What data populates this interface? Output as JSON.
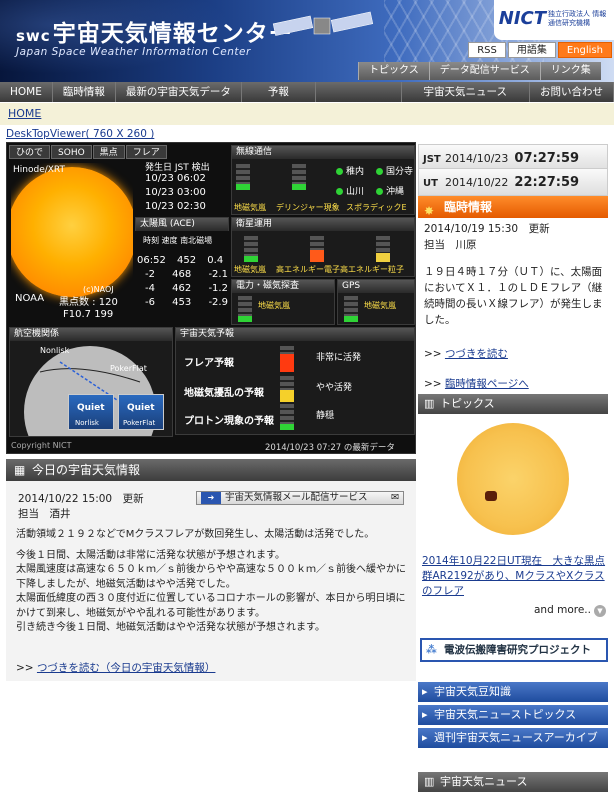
{
  "header": {
    "title_prefix": "swc",
    "title": "宇宙天気情報センター",
    "subtitle": "Japan Space Weather Information Center",
    "org": "NICT",
    "org_sub": "独立行政法人 情報通信研究機構",
    "links": [
      "RSS",
      "用語集",
      "English"
    ],
    "subnav": [
      "トピックス",
      "データ配信サービス",
      "リンク集"
    ]
  },
  "nav": {
    "left": [
      "HOME",
      "臨時情報",
      "最新の宇宙天気データ",
      "予報"
    ],
    "right": [
      "宇宙天気ニュース",
      "お問い合わせ"
    ]
  },
  "breadcrumb": "HOME",
  "viewer_link": "DeskTopViewer( 760 X 260 )",
  "viewer": {
    "tabs": [
      "ひので",
      "SOHO",
      "黒点",
      "フレア"
    ],
    "sun_label": "Hinode/XRT",
    "sun_credit": "(c)NAOJ",
    "noaa_label": "NOAA",
    "sunspot_label": "黒点数 : 120",
    "f107": "F10.7 199",
    "flare_hdr": "発生日 JST 検出",
    "flares": [
      "10/23 06:02",
      "10/23 03:00",
      "10/23 02:30"
    ],
    "wind_hdr": "太陽風 (ACE)",
    "wind_cols": "時刻 速度 南北磁場",
    "wind_rows": [
      [
        "06:52",
        "452",
        "0.4"
      ],
      [
        "-2",
        "468",
        "-2.1"
      ],
      [
        "-4",
        "462",
        "-1.2"
      ],
      [
        "-6",
        "453",
        "-2.9"
      ]
    ],
    "radio_hdr": "無線通信",
    "radio_sites": [
      "稚内",
      "国分寺",
      "山川",
      "沖縄"
    ],
    "radio_labels": [
      "地磁気嵐",
      "デリンジャー現象",
      "スポラディックE"
    ],
    "sat_hdr": "衛星運用",
    "sat_labels": [
      "地磁気嵐",
      "高エネルギー電子",
      "高エネルギー粒子"
    ],
    "power_hdr": "電力・磁気探査",
    "power_label": "地磁気嵐",
    "gps_hdr": "GPS",
    "gps_label": "地磁気嵐",
    "aviation_hdr": "航空機関係",
    "aviation_labels": [
      "Nonlisk",
      "PokerFlat",
      "Quiet",
      "Quiet",
      "Norlisk",
      "PokerFlat"
    ],
    "forecast_hdr": "宇宙天気予報",
    "forecast": [
      {
        "label": "フレア予報",
        "value": "非常に活発"
      },
      {
        "label": "地磁気擾乱の予報",
        "value": "やや活発"
      },
      {
        "label": "プロトン現象の予報",
        "value": "静穏"
      }
    ],
    "copyright": "Copyright NICT",
    "timestamp": "2014/10/23 07:27 の最新データ"
  },
  "clock": {
    "jst_label": "JST",
    "jst": "2014/10/23",
    "jst_time": "07:27:59",
    "ut_label": "UT",
    "ut": "2014/10/22",
    "ut_time": "22:27:59"
  },
  "rinji": {
    "title": "臨時情報",
    "date": "2014/10/19 15:30　更新",
    "author": "担当　川原",
    "body": "１９日４時１７分（ＵＴ）に、太陽面においてＸ１．１のＬＤＥフレア（継続時間の長いＸ線フレア）が発生しました。",
    "more": "つづきを読む",
    "page": "臨時情報ページへ"
  },
  "topics": {
    "title": "トピックス",
    "headline": "2014年10月22日UT現在　大きな黒点群AR2192があり、MクラスやXクラスのフレア",
    "more": "and more.."
  },
  "project": "電波伝搬障害研究プロジェクト",
  "side_links": [
    "宇宙天気豆知識",
    "宇宙天気ニューストピックス",
    "週刊宇宙天気ニュースアーカイブ"
  ],
  "news_hdr": "宇宙天気ニュース",
  "today": {
    "title": "今日の宇宙天気情報",
    "date": "2014/10/22 15:00　更新",
    "author": "担当　酒井",
    "mail": "宇宙天気情報メール配信サービス",
    "paras": [
      "活動領域２１９２などでMクラスフレアが数回発生し、太陽活動は活発でした。",
      "今後１日間、太陽活動は非常に活発な状態が予想されます。",
      "太陽風速度は高速な６５０ｋｍ／ｓ前後からやや高速な５００ｋｍ／ｓ前後へ緩やかに下降しましたが、地磁気活動はやや活発でした。",
      "太陽面低緯度の西３０度付近に位置しているコロナホールの影響が、本日から明日頃にかけて到来し、地磁気がやや乱れる可能性があります。",
      "引き続き今後１日間、地磁気活動はやや活発な状態が予想されます。"
    ],
    "more": "つづきを読む（今日の宇宙天気情報）"
  }
}
